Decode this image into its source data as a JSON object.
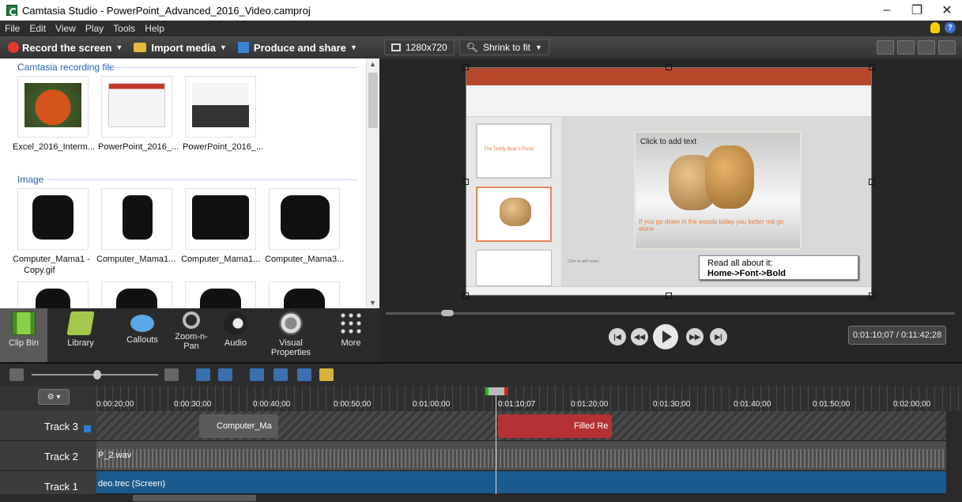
{
  "window": {
    "title": "Camtasia Studio - PowerPoint_Advanced_2016_Video.camproj",
    "controls": [
      "–",
      "❐",
      "✕"
    ]
  },
  "menu": [
    "File",
    "Edit",
    "View",
    "Play",
    "Tools",
    "Help"
  ],
  "left_toolbar": {
    "record": "Record the screen",
    "import": "Import media",
    "produce": "Produce and share"
  },
  "clip_bin": {
    "section_recording": "Camtasia recording file",
    "recording_items": [
      "Excel_2016_Interm...",
      "PowerPoint_2016_...",
      "PowerPoint_2016_..."
    ],
    "section_image": "Image",
    "image_items": [
      "Computer_Mama1 - Copy.gif",
      "Computer_Mama1...",
      "Computer_Mama1...",
      "Computer_Mama3..."
    ],
    "image_item_0_line1": "Computer_Mama1 -",
    "image_item_0_line2": "Copy.gif"
  },
  "tool_tabs": [
    {
      "label": "Clip Bin",
      "icon": "film-clip-icon"
    },
    {
      "label": "Library",
      "icon": "folder-icon"
    },
    {
      "label": "Callouts",
      "icon": "speech-bubble-icon"
    },
    {
      "label": "Zoom-n-\nPan",
      "icon": "magnifier-icon"
    },
    {
      "label": "Audio",
      "icon": "speaker-icon"
    },
    {
      "label": "Visual\nProperties",
      "icon": "visual-properties-icon"
    },
    {
      "label": "More",
      "icon": "more-dots-icon"
    }
  ],
  "preview_toolbar": {
    "resolution": "1280x720",
    "zoom": "Shrink to fit"
  },
  "preview": {
    "slide_text_placeholder": "Click to add text",
    "slide_body_text": "If you go down in the woods today you better not go alone",
    "thumb_title": "The Teddy Bear's Picnic",
    "notes_placeholder": "Click to add notes",
    "callout_line1": "Read all about it:",
    "callout_line2": "Home->Font->Bold"
  },
  "playback": {
    "time": "0:01:10;07 / 0:11:42;28"
  },
  "timeline": {
    "ticks": [
      "0:00:20;00",
      "0:00:30;00",
      "0:00:40;00",
      "0:00:50;00",
      "0:01:00;00",
      "0:01:20;00",
      "0:01:30;00",
      "0:01:40;00",
      "0:01:50;00",
      "0:02:00;00"
    ],
    "playhead": "0:01:10;07",
    "tracks": [
      {
        "name": "Track 3"
      },
      {
        "name": "Track 2"
      },
      {
        "name": "Track 1"
      }
    ],
    "clips": {
      "track3_clip1": "Computer_Ma",
      "track3_clip2": "Filled Re",
      "track2_clip": "P_2.wav",
      "track1_clip": "deo.trec (Screen)"
    }
  },
  "colors": {
    "accent_blue": "#2a63b8",
    "record_red": "#e23a2a",
    "track_video": "#1b5a8c",
    "clip_red": "#b63232"
  }
}
